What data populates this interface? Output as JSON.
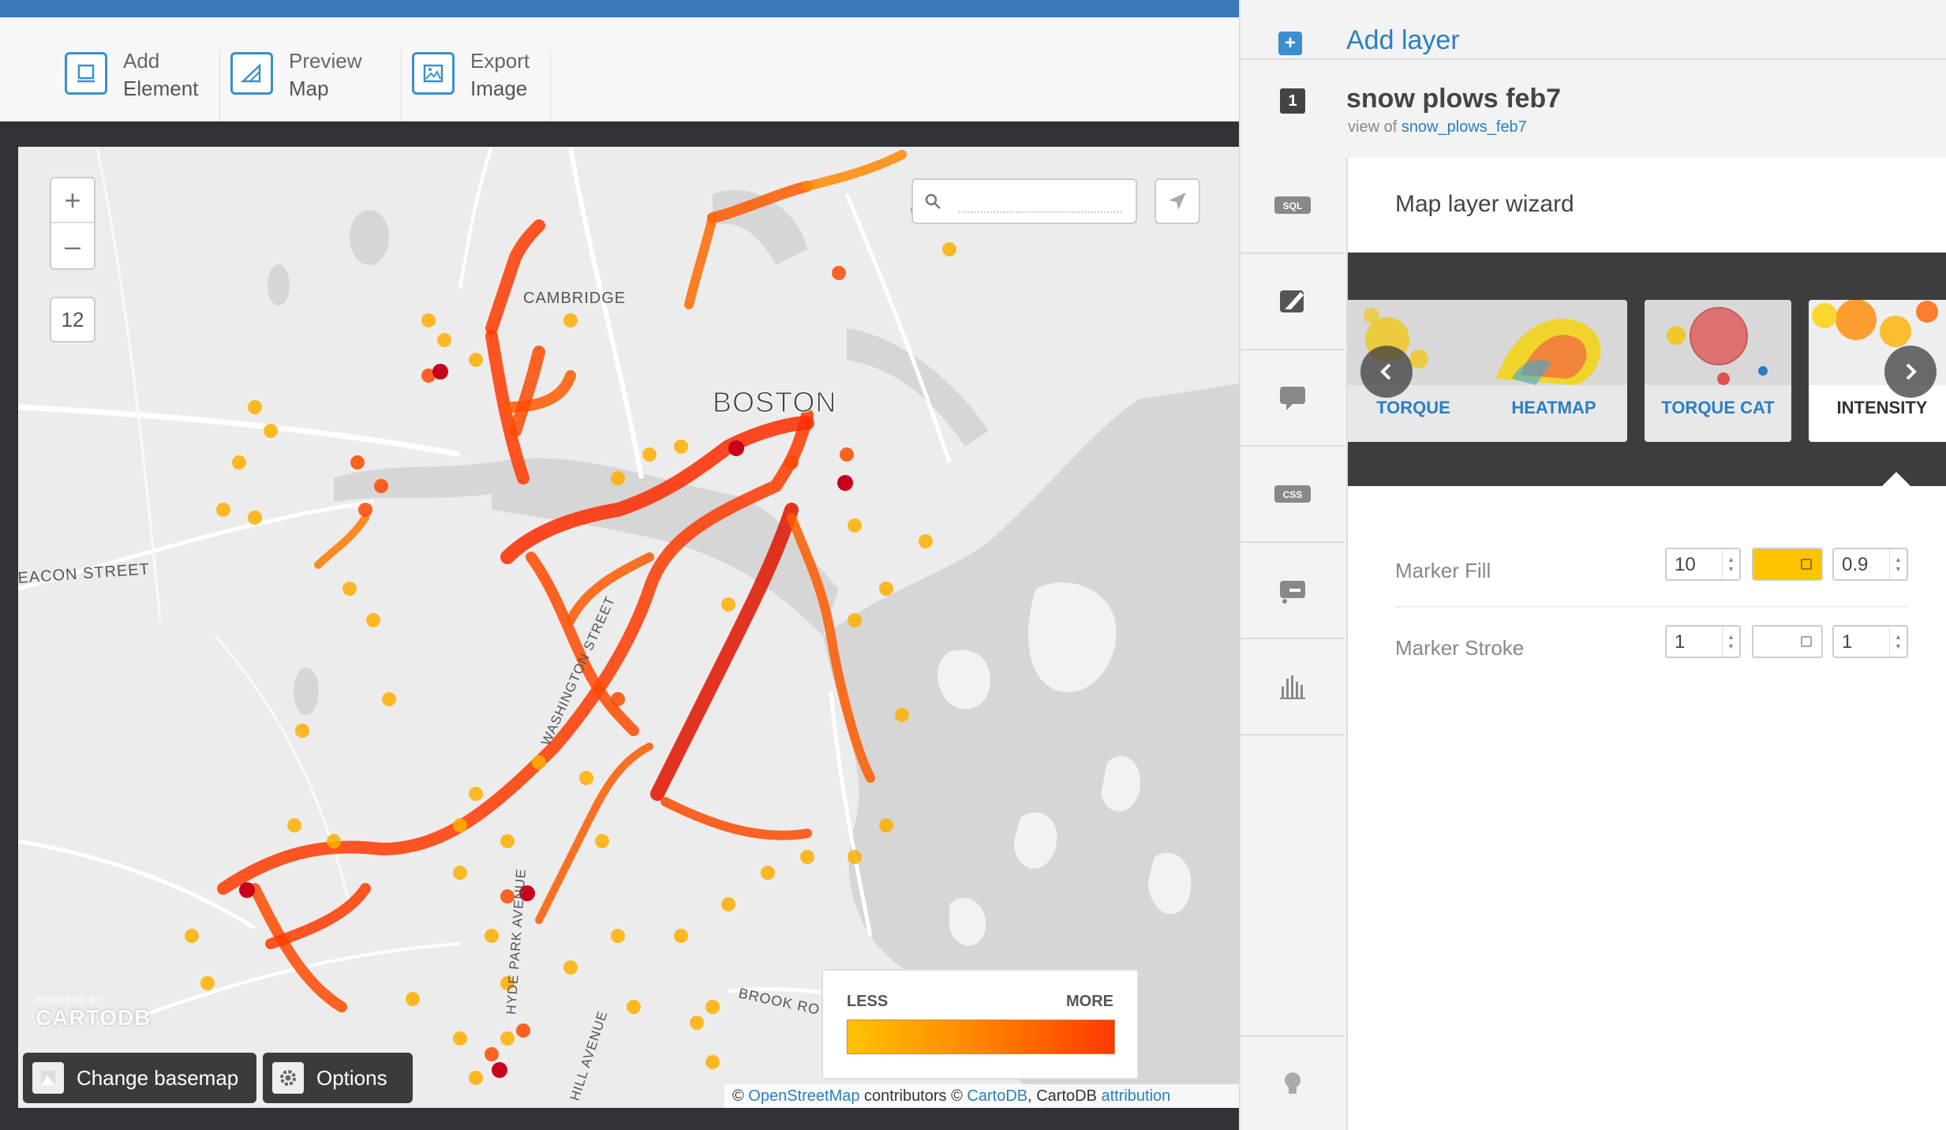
{
  "toolbar": {
    "add_element": {
      "line1": "Add",
      "line2": "Element"
    },
    "preview_map": {
      "line1": "Preview",
      "line2": "Map"
    },
    "export_image": {
      "line1": "Export",
      "line2": "Image"
    }
  },
  "map": {
    "zoom_in": "+",
    "zoom_out": "–",
    "zoom_level": "12",
    "search_placeholder": "",
    "labels": {
      "cambridge": "CAMBRIDGE",
      "boston": "BOSTON",
      "beacon": "EACON STREET",
      "washington": "WASHINGTON STREET",
      "hydepark": "HYDE PARK AVENUE",
      "brook": "BROOK RO",
      "hill": "HILL AVENUE"
    },
    "powered_by": "POWERED BY",
    "powered_brand": "CARTODB",
    "change_basemap": "Change basemap",
    "options": "Options",
    "legend": {
      "less": "LESS",
      "more": "MORE"
    },
    "attribution": {
      "c1": "© ",
      "osm": "OpenStreetMap",
      "c2": " contributors © ",
      "cartodb": "CartoDB",
      "c3": ", CartoDB ",
      "attr": "attribution"
    },
    "colors": {
      "low": "#ffc300",
      "mid": "#ff8a00",
      "high": "#ff3a00",
      "dark": "#c8001a"
    }
  },
  "panel": {
    "add_layer": "Add layer",
    "layer_number": "1",
    "layer_name": "snow plows feb7",
    "view_of_prefix": "view of ",
    "view_of_table": "snow_plows_feb7",
    "sidebar_icons": [
      "sql-icon",
      "wizard-brush-icon",
      "infowindow-icon",
      "css-icon",
      "legend-icon",
      "filters-chart-icon"
    ],
    "sql_text": "SQL",
    "css_text": "CSS",
    "wizard_title": "Map layer wizard",
    "wizard_cards": [
      {
        "label": "TORQUE"
      },
      {
        "label": "HEATMAP"
      },
      {
        "label": "TORQUE CAT"
      },
      {
        "label": "INTENSITY"
      }
    ],
    "marker_fill": {
      "label": "Marker Fill",
      "width": "10",
      "color": "#ffc300",
      "opacity": "0.9"
    },
    "marker_stroke": {
      "label": "Marker Stroke",
      "width": "1",
      "color": "#ffffff",
      "opacity": "1"
    }
  }
}
